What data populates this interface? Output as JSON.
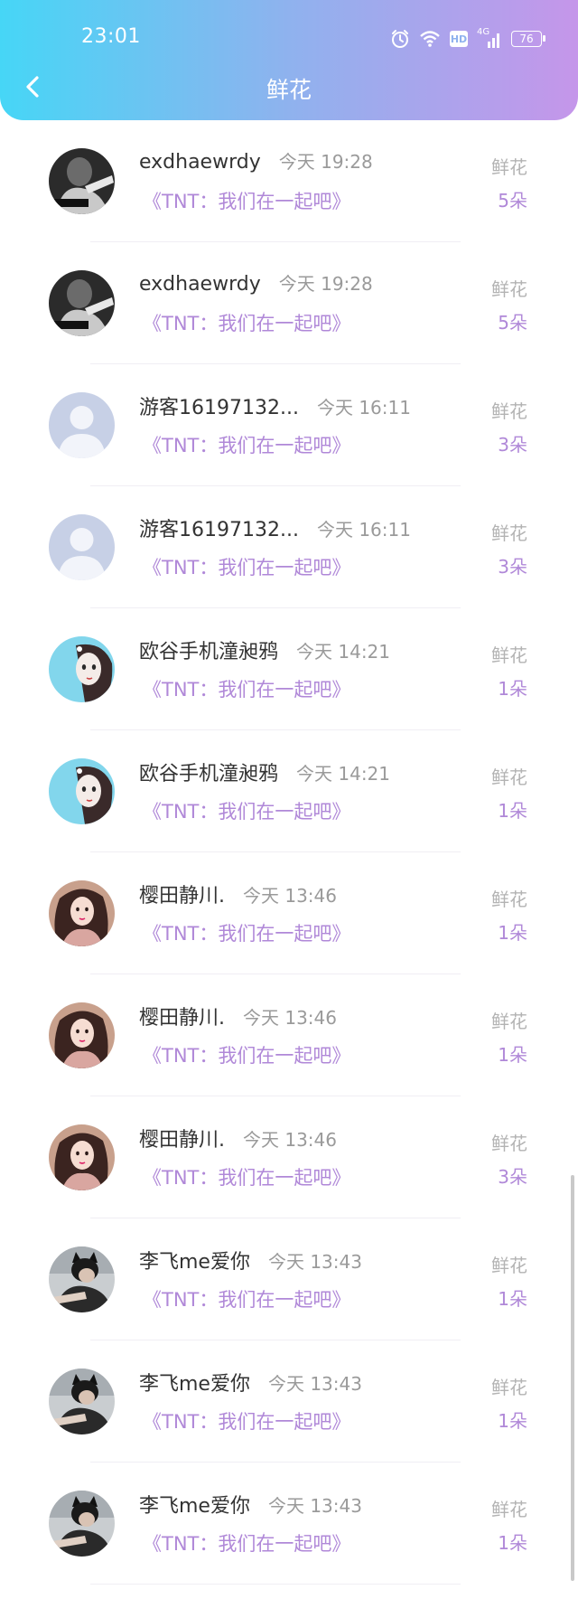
{
  "status_bar": {
    "time": "23:01",
    "hd_label": "HD",
    "network_label": "4G",
    "battery": "76"
  },
  "header": {
    "title": "鲜花"
  },
  "gifts": [
    {
      "username": "exdhaewrdy",
      "time": "今天 19:28",
      "song": "《TNT：我们在一起吧》",
      "label": "鲜花",
      "count": "5朵",
      "avatar": "dark"
    },
    {
      "username": "exdhaewrdy",
      "time": "今天 19:28",
      "song": "《TNT：我们在一起吧》",
      "label": "鲜花",
      "count": "5朵",
      "avatar": "dark"
    },
    {
      "username": "游客16197132...",
      "time": "今天 16:11",
      "song": "《TNT：我们在一起吧》",
      "label": "鲜花",
      "count": "3朵",
      "avatar": "default"
    },
    {
      "username": "游客16197132...",
      "time": "今天 16:11",
      "song": "《TNT：我们在一起吧》",
      "label": "鲜花",
      "count": "3朵",
      "avatar": "default"
    },
    {
      "username": "欧谷手机潼昶鸦",
      "time": "今天 14:21",
      "song": "《TNT：我们在一起吧》",
      "label": "鲜花",
      "count": "1朵",
      "avatar": "anime"
    },
    {
      "username": "欧谷手机潼昶鸦",
      "time": "今天 14:21",
      "song": "《TNT：我们在一起吧》",
      "label": "鲜花",
      "count": "1朵",
      "avatar": "anime"
    },
    {
      "username": "樱田静川.",
      "time": "今天 13:46",
      "song": "《TNT：我们在一起吧》",
      "label": "鲜花",
      "count": "1朵",
      "avatar": "girl"
    },
    {
      "username": "樱田静川.",
      "time": "今天 13:46",
      "song": "《TNT：我们在一起吧》",
      "label": "鲜花",
      "count": "1朵",
      "avatar": "girl"
    },
    {
      "username": "樱田静川.",
      "time": "今天 13:46",
      "song": "《TNT：我们在一起吧》",
      "label": "鲜花",
      "count": "3朵",
      "avatar": "girl"
    },
    {
      "username": "李飞me爱你",
      "time": "今天 13:43",
      "song": "《TNT：我们在一起吧》",
      "label": "鲜花",
      "count": "1朵",
      "avatar": "cat"
    },
    {
      "username": "李飞me爱你",
      "time": "今天 13:43",
      "song": "《TNT：我们在一起吧》",
      "label": "鲜花",
      "count": "1朵",
      "avatar": "cat"
    },
    {
      "username": "李飞me爱你",
      "time": "今天 13:43",
      "song": "《TNT：我们在一起吧》",
      "label": "鲜花",
      "count": "1朵",
      "avatar": "cat"
    }
  ],
  "colors": {
    "header_gradient_start": "#46d6f6",
    "header_gradient_end": "#c596ea",
    "accent_purple": "#b088d8"
  }
}
